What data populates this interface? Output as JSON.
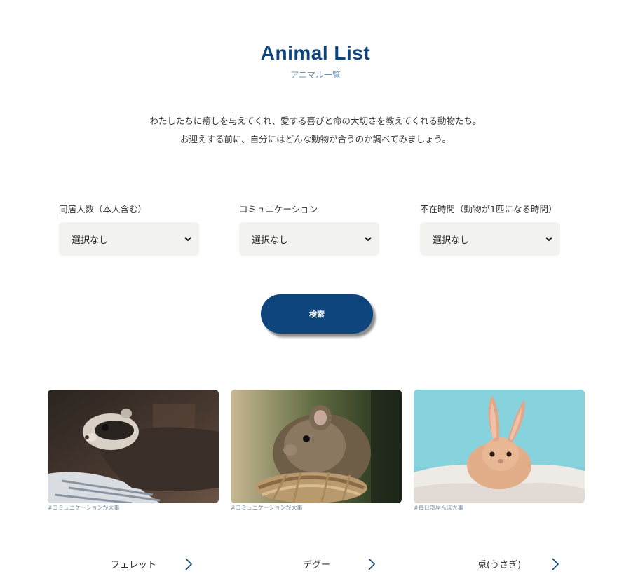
{
  "header": {
    "title": "Animal List",
    "subtitle": "アニマル一覧"
  },
  "intro": {
    "line1": "わたしたちに癒しを与えてくれ、愛する喜びと命の大切さを教えてくれる動物たち。",
    "line2": "お迎えする前に、自分にはどんな動物が合うのか調べてみましょう。"
  },
  "filters": [
    {
      "label": "同居人数（本人含む）",
      "value": "選択なし"
    },
    {
      "label": "コミュニケーション",
      "value": "選択なし"
    },
    {
      "label": "不在時間（動物が1匹になる時間）",
      "value": "選択なし"
    }
  ],
  "search": {
    "label": "検索"
  },
  "colors": {
    "brand": "#0d457c",
    "select_bg": "#f2f2f0",
    "tag": "#7a8ea6"
  },
  "animals": [
    {
      "tag": "#コミュニケーションが大事",
      "name": "フェレット",
      "photo": "ferret-photo",
      "icon": "chevron-right-icon"
    },
    {
      "tag": "#コミュニケーションが大事",
      "name": "デグー",
      "photo": "degu-photo",
      "icon": "chevron-right-icon"
    },
    {
      "tag": "#毎日部屋んぽ大事",
      "name": "兎(うさぎ)",
      "photo": "rabbit-photo",
      "icon": "chevron-right-icon"
    }
  ]
}
